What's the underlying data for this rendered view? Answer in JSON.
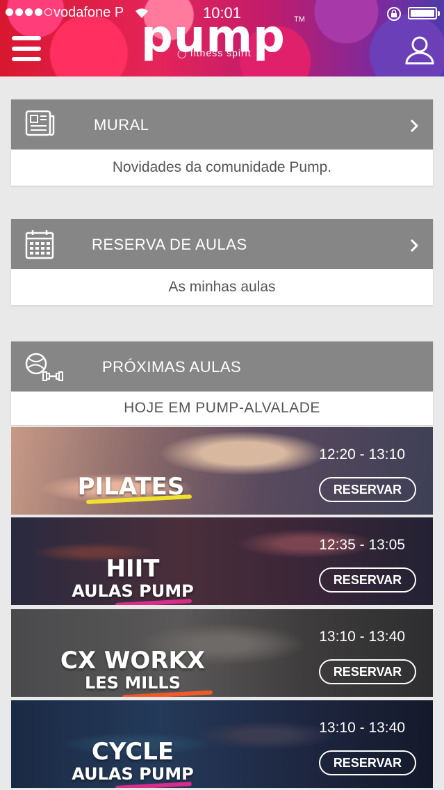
{
  "status_bar": {
    "carrier": "vodafone P",
    "time": "10:01",
    "signal_bars_filled": 4,
    "signal_bars_total": 5,
    "battery_level": 1.0
  },
  "header": {
    "logo_word": "pump",
    "logo_tagline": "fitness spirit",
    "logo_tm": "TM",
    "menu_icon": "hamburger-icon",
    "user_icon": "user-icon"
  },
  "mural": {
    "title": "MURAL",
    "subtitle": "Novidades da comunidade Pump.",
    "icon": "newspaper-icon"
  },
  "reserva": {
    "title": "RESERVA DE AULAS",
    "subtitle": "As minhas aulas",
    "icon": "calendar-icon"
  },
  "proximas": {
    "title": "PRÓXIMAS AULAS",
    "subtitle": "HOJE EM PUMP-ALVALADE",
    "icon": "ball-dumbbell-icon"
  },
  "classes": [
    {
      "name": "PILATES",
      "subtitle": "",
      "time": "12:20 - 13:10",
      "button": "RESERVAR",
      "accent": "#f2e12a"
    },
    {
      "name": "HIIT",
      "subtitle": "AULAS PUMP",
      "time": "12:35 - 13:05",
      "button": "RESERVAR",
      "accent": "#d92d8c"
    },
    {
      "name": "CX WORKX",
      "subtitle": "LES MILLS",
      "time": "13:10 - 13:40",
      "button": "RESERVAR",
      "accent": "#f05a28"
    },
    {
      "name": "CYCLE",
      "subtitle": "AULAS PUMP",
      "time": "13:10 - 13:40",
      "button": "RESERVAR",
      "accent": "#d92d8c"
    }
  ]
}
